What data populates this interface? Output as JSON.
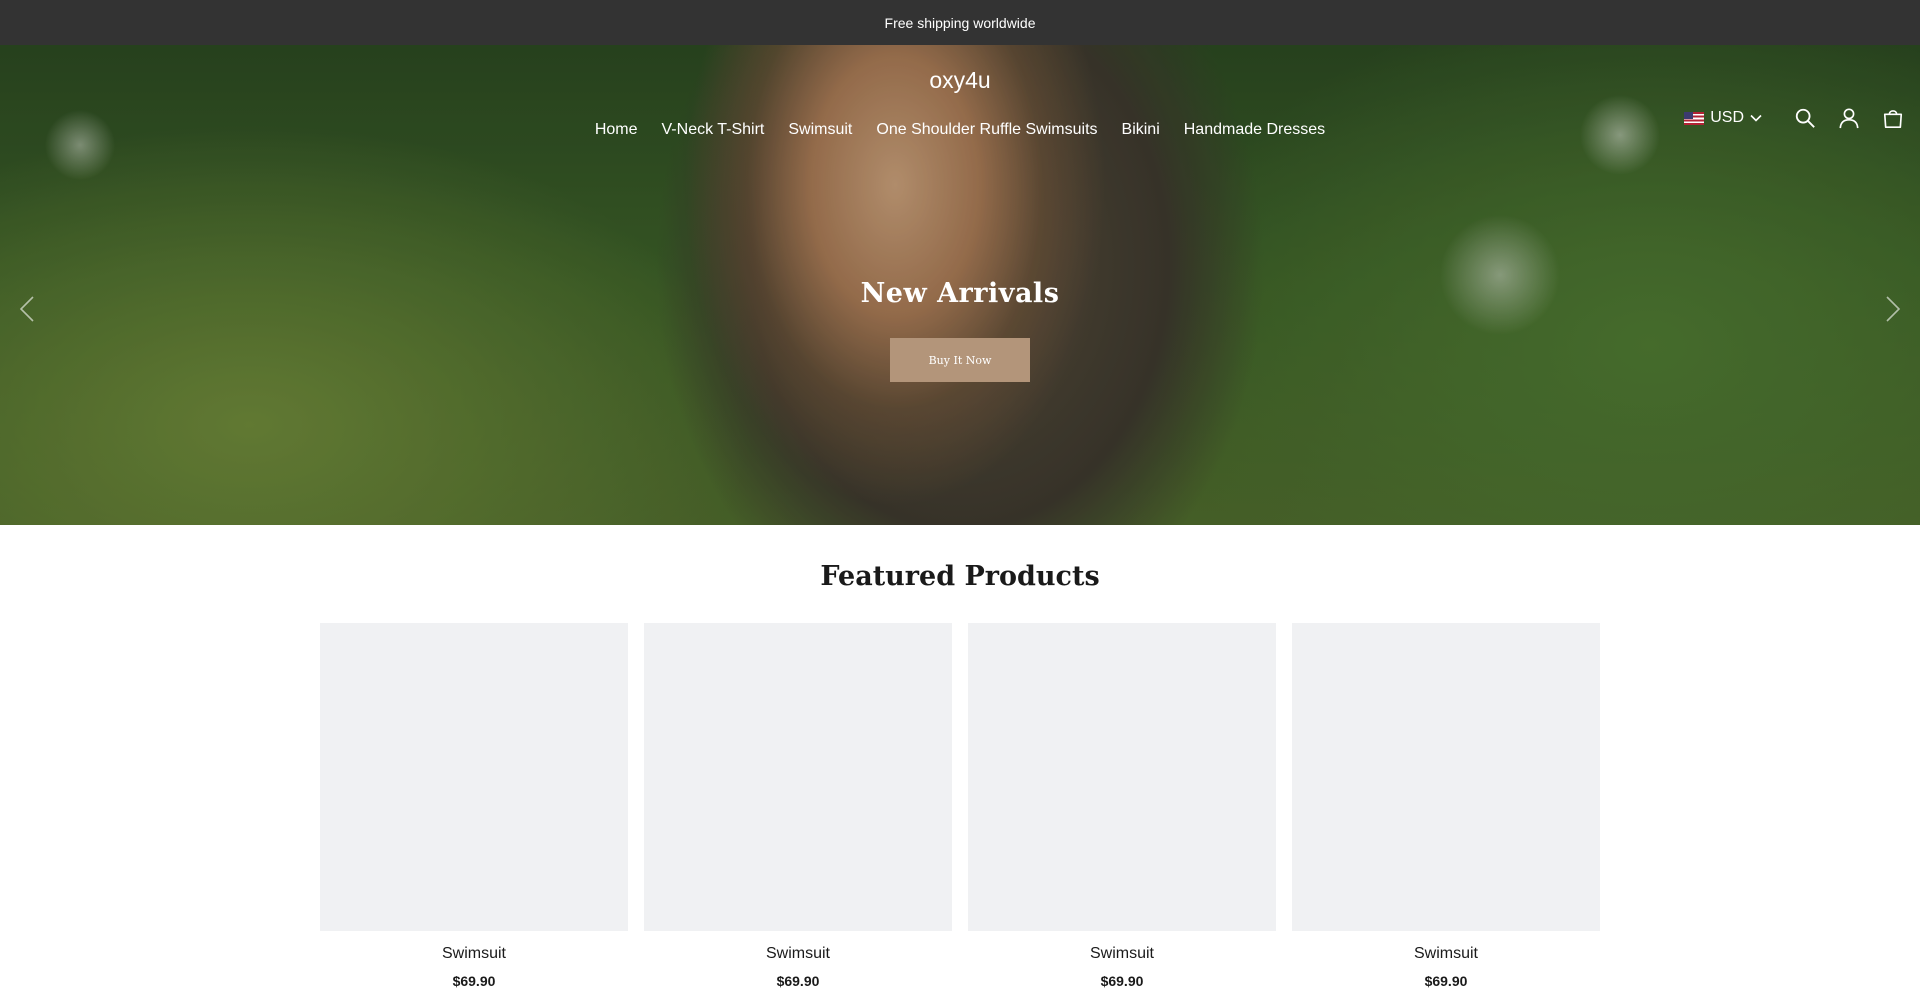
{
  "announcement": {
    "text": "Free shipping worldwide"
  },
  "header": {
    "logo": "oxy4u",
    "nav": [
      {
        "label": "Home"
      },
      {
        "label": "V-Neck T-Shirt"
      },
      {
        "label": "Swimsuit"
      },
      {
        "label": "One Shoulder Ruffle Swimsuits"
      },
      {
        "label": "Bikini"
      },
      {
        "label": "Handmade Dresses"
      }
    ],
    "currency": {
      "label": "USD",
      "flag_icon": "us-flag-icon",
      "chevron_icon": "chevron-down-icon"
    },
    "icons": [
      "search-icon",
      "account-icon",
      "cart-icon"
    ]
  },
  "hero": {
    "title": "New Arrivals",
    "button_label": "Buy It Now",
    "arrows": [
      "chevron-left-icon",
      "chevron-right-icon"
    ],
    "slides": [
      {
        "active": false
      },
      {
        "active": true
      }
    ]
  },
  "featured": {
    "title": "Featured Products",
    "products": [
      {
        "name": "Swimsuit",
        "price": "$69.90"
      },
      {
        "name": "Swimsuit",
        "price": "$69.90"
      },
      {
        "name": "Swimsuit",
        "price": "$69.90"
      },
      {
        "name": "Swimsuit",
        "price": "$69.90"
      }
    ]
  },
  "colors": {
    "announcement_bg": "#333333",
    "button_bg": "#b3957a",
    "product_placeholder": "#f0f1f3"
  }
}
